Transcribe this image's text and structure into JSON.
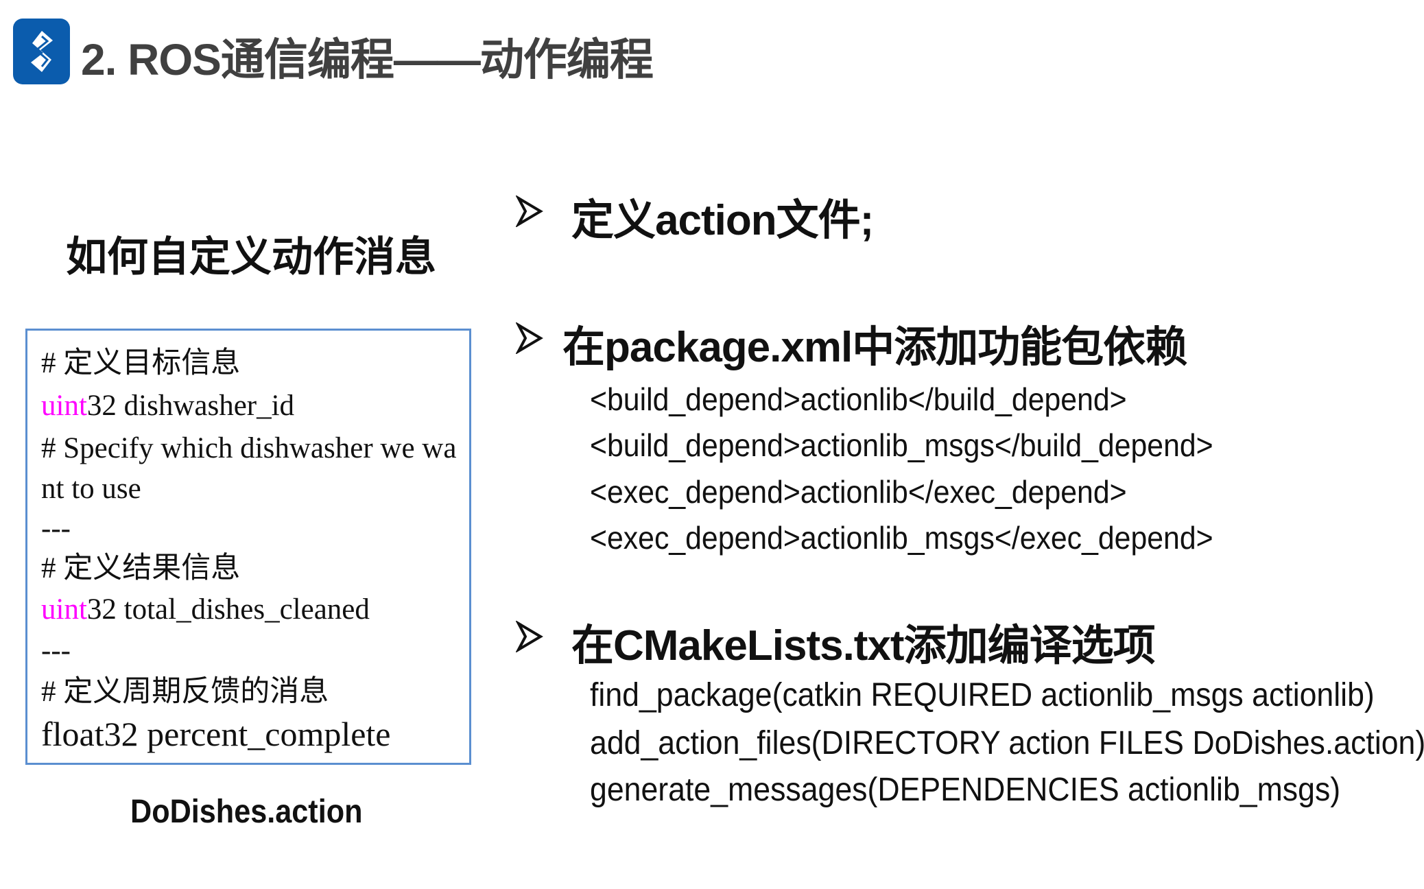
{
  "header": {
    "title": "2. ROS通信编程——动作编程",
    "logo_icon": "dollar-s-logo",
    "logo_color": "#0b5cad"
  },
  "left": {
    "heading": "如何自定义动作消息",
    "code_lines": [
      {
        "pre": "",
        "kw": "",
        "text": "# 定义目标信息"
      },
      {
        "pre": "",
        "kw": "uint",
        "text": "32 dishwasher_id"
      },
      {
        "pre": "",
        "kw": "",
        "text": "# Specify which dishwasher we wa"
      },
      {
        "pre": "",
        "kw": "",
        "text": "nt to use"
      },
      {
        "pre": "",
        "kw": "",
        "text": "---"
      },
      {
        "pre": "",
        "kw": "",
        "text": "# 定义结果信息"
      },
      {
        "pre": "",
        "kw": "uint",
        "text": "32 total_dishes_cleaned"
      },
      {
        "pre": "",
        "kw": "",
        "text": "---"
      },
      {
        "pre": "",
        "kw": "",
        "text": "# 定义周期反馈的消息"
      },
      {
        "pre": "",
        "kw": "",
        "text": "float32 percent_complete"
      }
    ],
    "keyword_color": "#ff00ff",
    "caption": "DoDishes.action"
  },
  "right": {
    "sections": [
      {
        "title": "定义action文件;",
        "lines": []
      },
      {
        "title": "在package.xml中添加功能包依赖",
        "lines": [
          "<build_depend>actionlib</build_depend>",
          "<build_depend>actionlib_msgs</build_depend>",
          "<exec_depend>actionlib</exec_depend>",
          "<exec_depend>actionlib_msgs</exec_depend>"
        ]
      },
      {
        "title": "在CMakeLists.txt添加编译选项",
        "lines": [
          "find_package(catkin REQUIRED actionlib_msgs actionlib)",
          "add_action_files(DIRECTORY action FILES DoDishes.action)",
          "generate_messages(DEPENDENCIES actionlib_msgs)"
        ]
      }
    ],
    "bullet_icon": "arrow-bullet"
  }
}
